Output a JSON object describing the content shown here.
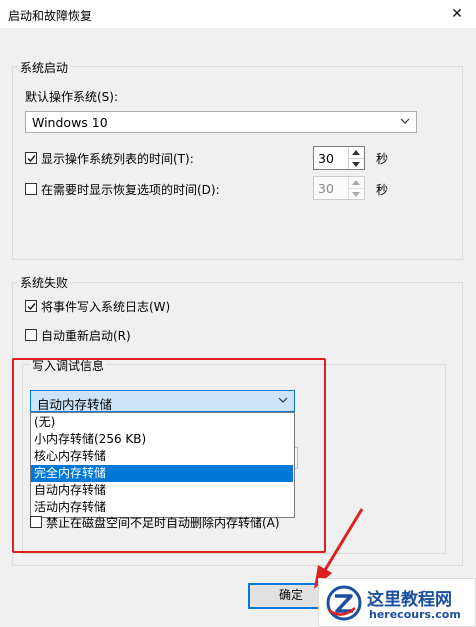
{
  "window": {
    "title": "启动和故障恢复",
    "close_glyph": "✕"
  },
  "system_startup": {
    "group_label": "系统启动",
    "default_os_label": "默认操作系统(S):",
    "default_os_value": "Windows 10",
    "show_os_list_label": "显示操作系统列表的时间(T):",
    "show_os_list_checked": true,
    "show_os_list_value": "30",
    "show_recovery_label": "在需要时显示恢复选项的时间(D):",
    "show_recovery_checked": false,
    "show_recovery_value": "30",
    "unit_seconds": "秒"
  },
  "system_failure": {
    "group_label": "系统失败",
    "write_event_label": "将事件写入系统日志(W)",
    "write_event_checked": true,
    "auto_restart_label": "自动重新启动(R)",
    "auto_restart_checked": false,
    "debug_info_label": "写入调试信息",
    "debug_selected": "自动内存转储",
    "debug_options": [
      "(无)",
      "小内存转储(256 KB)",
      "核心内存转储",
      "完全内存转储",
      "自动内存转储",
      "活动内存转储"
    ],
    "highlighted_option_index": 3,
    "disable_auto_delete_label": "禁止在磁盘空间不足时自动删除内存转储(A)"
  },
  "buttons": {
    "ok": "确定"
  },
  "colors": {
    "highlight": "#0078d7",
    "annotation_red": "#e02020"
  },
  "watermark": {
    "brand": "这里教程网",
    "domain": "herecours.com"
  }
}
